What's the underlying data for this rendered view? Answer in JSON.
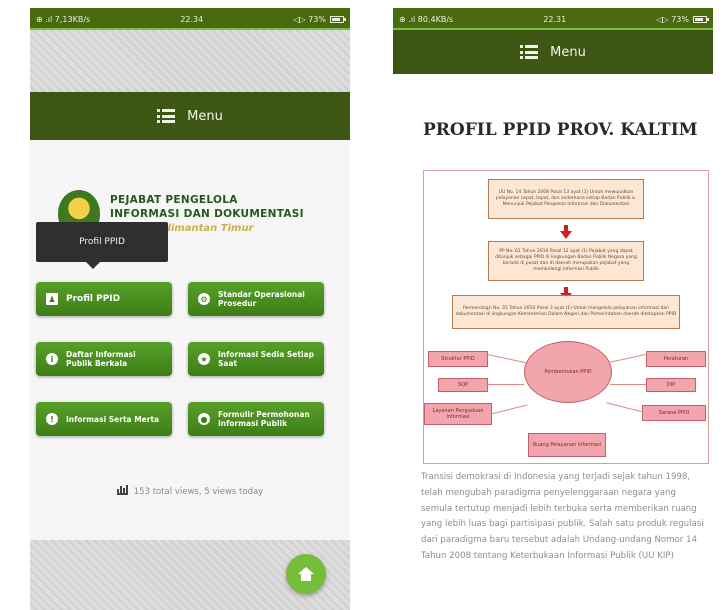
{
  "left_phone": {
    "status": {
      "left": "⊕ .ıl 7,13KB/s",
      "time": "22.34",
      "right": "◁▷ 73%"
    },
    "menu_label": "Menu",
    "logo": {
      "line1": "PEJABAT PENGELOLA",
      "line2": "INFORMASI DAN DOKUMENTASI",
      "line3": "Kalimantan Timur"
    },
    "tooltip": "Profil PPID",
    "buttons": [
      {
        "label": "Profil PPID",
        "icon": "person-icon"
      },
      {
        "label": "Standar Operasional Prosedur",
        "icon": "gear-icon"
      },
      {
        "label": "Daftar Informasi Publik Berkala",
        "icon": "info-icon"
      },
      {
        "label": "Informasi Sedia Setiap Saat",
        "icon": "star-icon"
      },
      {
        "label": "Informasi Serta Merta",
        "icon": "alert-icon"
      },
      {
        "label": "Formulir Permohonan Informasi Publik",
        "icon": "chat-icon"
      }
    ],
    "views": "153 total views, 5 views today"
  },
  "right_phone": {
    "status": {
      "left": "⊕ .ıl 80,4KB/s",
      "time": "22.31",
      "right": "◁▷ 73%"
    },
    "menu_label": "Menu",
    "title": "PROFIL PPID PROV. KALTIM",
    "diagram": {
      "box1": "UU No. 14 Tahun 2008 Pasal 13 ayat (1) Untuk mewujudkan pelayanan cepat, tepat, dan sederhana setiap Badan Publik a. Menunjuk Pejabat Pengelola Informasi dan Dokumentasi",
      "box2": "PP No. 61 Tahun 2010 Pasal 12 ayat (1) Pejabat yang dapat ditunjuk sebagai PPID di lingkungan Badan Publik Negara yang berada di pusat dan di daerah merupakan pejabat yang membidangi Informasi Publik",
      "box3": "Permendagri No. 35 Tahun 2010 Pasal 3 ayat (1) Untuk mengelola pelayanan informasi dan dokumentasi di lingkungan Kementerian Dalam Negeri dan Pemerintahan daerah ditetapkan PPID",
      "center": "Pembentukan PPID",
      "left_items": [
        "Struktur PPID",
        "SOP",
        "Layanan Pengaduan Informasi"
      ],
      "right_items": [
        "Peraturan",
        "DIP",
        "Sarana PPID"
      ],
      "bottom": "Ruang Pelayanan Informasi"
    },
    "article": "Transisi demokrasi di Indonesia yang terjadi sejak tahun 1998, telah mengubah paradigma penyelenggaraan negara yang semula tertutup menjadi lebih terbuka serta memberikan ruang yang lebih luas bagi partisipasi publik. Salah satu produk regulasi dari paradigma baru tersebut adalah Undang-undang Nomor 14 Tahun 2008 tentang Keterbukaan Informasi Publik (UU KIP)"
  },
  "colors": {
    "header": "#3e5613",
    "status": "#4a6a10",
    "button": "#4a8e20",
    "fab": "#75bd3a"
  }
}
